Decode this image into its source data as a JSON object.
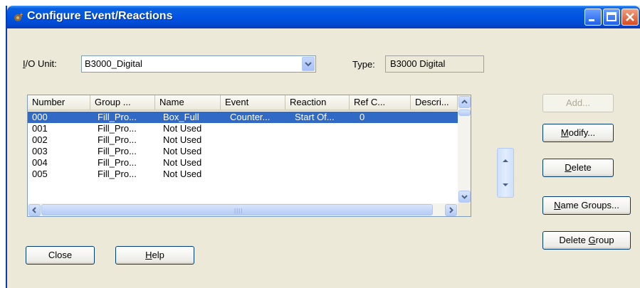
{
  "window": {
    "title": "Configure Event/Reactions"
  },
  "io_unit": {
    "label": "I/O Unit:",
    "mnemonic": "I",
    "label_rest": "/O Unit:",
    "value": "B3000_Digital"
  },
  "type": {
    "label": "Type:",
    "value": "B3000 Digital"
  },
  "table": {
    "columns": [
      "Number",
      "Group ...",
      "Name",
      "Event",
      "Reaction",
      "Ref C...",
      "Descri..."
    ],
    "rows": [
      {
        "number": "000",
        "group": "Fill_Pro...",
        "name": "Box_Full",
        "event": "Counter...",
        "reaction": "Start Of...",
        "ref": "0",
        "selected": true
      },
      {
        "number": "001",
        "group": "Fill_Pro...",
        "name": "Not Used",
        "event": "",
        "reaction": "",
        "ref": "",
        "selected": false
      },
      {
        "number": "002",
        "group": "Fill_Pro...",
        "name": "Not Used",
        "event": "",
        "reaction": "",
        "ref": "",
        "selected": false
      },
      {
        "number": "003",
        "group": "Fill_Pro...",
        "name": "Not Used",
        "event": "",
        "reaction": "",
        "ref": "",
        "selected": false
      },
      {
        "number": "004",
        "group": "Fill_Pro...",
        "name": "Not Used",
        "event": "",
        "reaction": "",
        "ref": "",
        "selected": false
      },
      {
        "number": "005",
        "group": "Fill_Pro...",
        "name": "Not Used",
        "event": "",
        "reaction": "",
        "ref": "",
        "selected": false
      }
    ]
  },
  "buttons": {
    "add": {
      "label": "Add...",
      "enabled": false
    },
    "modify": {
      "mnemonic": "M",
      "rest": "odify..."
    },
    "delete": {
      "mnemonic": "D",
      "rest": "elete"
    },
    "name_groups": {
      "mnemonic": "N",
      "rest": "ame Groups..."
    },
    "delete_group": {
      "prefix": "Delete ",
      "mnemonic": "G",
      "rest": "roup"
    },
    "close": {
      "label": "Close"
    },
    "help": {
      "mnemonic": "H",
      "rest": "elp"
    }
  },
  "icons": {
    "app": "gear-flame-icon",
    "minimize": "minimize-icon",
    "maximize": "maximize-icon",
    "close": "close-x-icon",
    "dropdown": "chevron-down-icon",
    "scroll_up": "scroll-up-arrow-icon",
    "scroll_down": "scroll-down-arrow-icon",
    "scroll_left": "scroll-left-arrow-icon",
    "scroll_right": "scroll-right-arrow-icon",
    "move_up": "move-up-arrow-icon",
    "move_down": "move-down-arrow-icon"
  },
  "colors": {
    "titlebar": "#0054e3",
    "selection": "#316ac5",
    "dialog": "#ece9d8"
  }
}
